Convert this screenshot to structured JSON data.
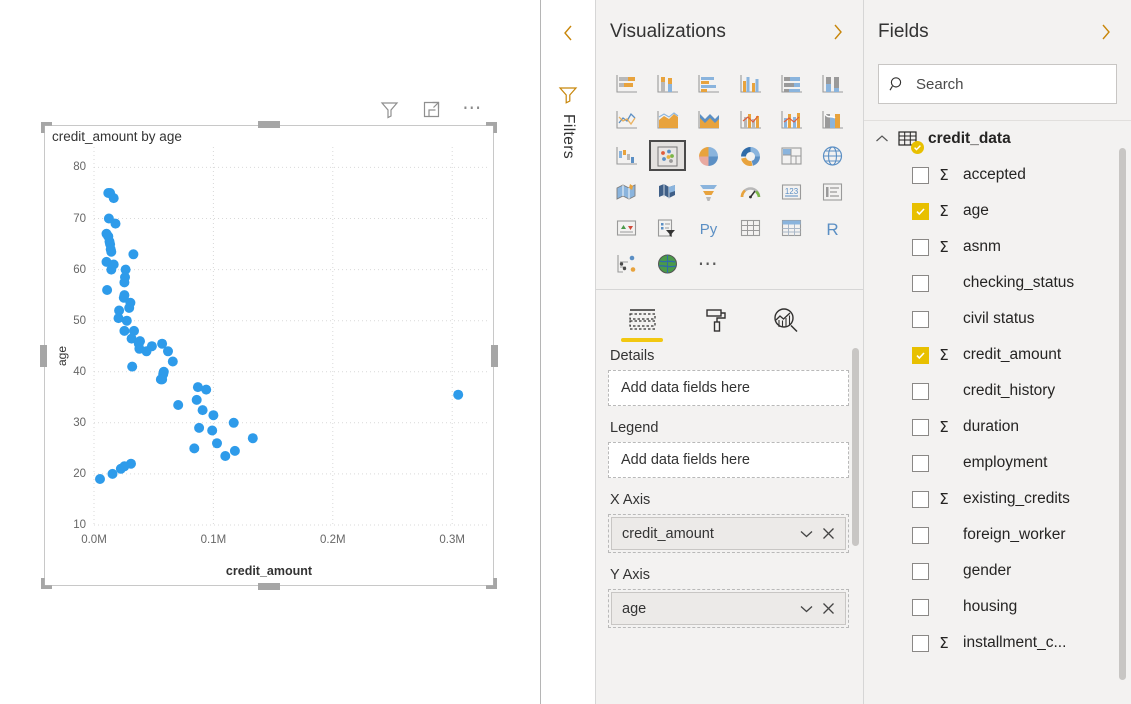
{
  "canvas": {
    "visual_header_icons": [
      {
        "name": "filter-icon",
        "label": "Filters"
      },
      {
        "name": "focus-mode-icon",
        "label": "Focus mode"
      },
      {
        "name": "more-options-icon",
        "label": "More options"
      }
    ]
  },
  "chart_data": {
    "type": "scatter",
    "title": "credit_amount by age",
    "xlabel": "credit_amount",
    "ylabel": "age",
    "xlim": [
      0,
      330000
    ],
    "ylim": [
      10,
      84
    ],
    "grid": true,
    "legend": "none",
    "point_color": "#2e9bea",
    "point_radius": 5,
    "xticks": [
      {
        "value": 0,
        "label": "0.0M"
      },
      {
        "value": 100000,
        "label": "0.1M"
      },
      {
        "value": 200000,
        "label": "0.2M"
      },
      {
        "value": 300000,
        "label": "0.3M"
      }
    ],
    "yticks": [
      {
        "value": 80,
        "label": "80"
      },
      {
        "value": 70,
        "label": "70"
      },
      {
        "value": 60,
        "label": "60"
      },
      {
        "value": 50,
        "label": "50"
      },
      {
        "value": 40,
        "label": "40"
      },
      {
        "value": 30,
        "label": "30"
      },
      {
        "value": 20,
        "label": "20"
      },
      {
        "value": 10,
        "label": "10"
      }
    ],
    "points": [
      {
        "x": 12000,
        "y": 75
      },
      {
        "x": 13500,
        "y": 75
      },
      {
        "x": 16500,
        "y": 74
      },
      {
        "x": 12500,
        "y": 70
      },
      {
        "x": 18000,
        "y": 69
      },
      {
        "x": 10500,
        "y": 67
      },
      {
        "x": 12000,
        "y": 66.5
      },
      {
        "x": 13000,
        "y": 65.5
      },
      {
        "x": 13500,
        "y": 65
      },
      {
        "x": 14000,
        "y": 64
      },
      {
        "x": 14500,
        "y": 63.5
      },
      {
        "x": 33000,
        "y": 63
      },
      {
        "x": 10500,
        "y": 61.5
      },
      {
        "x": 16500,
        "y": 61
      },
      {
        "x": 14500,
        "y": 60
      },
      {
        "x": 26500,
        "y": 60
      },
      {
        "x": 26000,
        "y": 58.5
      },
      {
        "x": 25500,
        "y": 57.5
      },
      {
        "x": 11000,
        "y": 56
      },
      {
        "x": 25500,
        "y": 55
      },
      {
        "x": 25000,
        "y": 54.5
      },
      {
        "x": 30500,
        "y": 53.5
      },
      {
        "x": 21000,
        "y": 52
      },
      {
        "x": 29500,
        "y": 52.5
      },
      {
        "x": 20500,
        "y": 50.5
      },
      {
        "x": 27500,
        "y": 50
      },
      {
        "x": 25500,
        "y": 48
      },
      {
        "x": 33500,
        "y": 48
      },
      {
        "x": 31500,
        "y": 46.5
      },
      {
        "x": 38500,
        "y": 46
      },
      {
        "x": 37500,
        "y": 45.5
      },
      {
        "x": 38000,
        "y": 44.5
      },
      {
        "x": 48500,
        "y": 45
      },
      {
        "x": 57000,
        "y": 45.5
      },
      {
        "x": 44000,
        "y": 44
      },
      {
        "x": 62000,
        "y": 44
      },
      {
        "x": 32000,
        "y": 41
      },
      {
        "x": 66000,
        "y": 42
      },
      {
        "x": 58500,
        "y": 40
      },
      {
        "x": 58000,
        "y": 39.5
      },
      {
        "x": 56000,
        "y": 38.5
      },
      {
        "x": 57000,
        "y": 38.5
      },
      {
        "x": 87000,
        "y": 37
      },
      {
        "x": 94000,
        "y": 36.5
      },
      {
        "x": 305000,
        "y": 35.5
      },
      {
        "x": 86000,
        "y": 34.5
      },
      {
        "x": 70500,
        "y": 33.5
      },
      {
        "x": 91000,
        "y": 32.5
      },
      {
        "x": 100000,
        "y": 31.5
      },
      {
        "x": 117000,
        "y": 30
      },
      {
        "x": 88000,
        "y": 29
      },
      {
        "x": 99000,
        "y": 28.5
      },
      {
        "x": 133000,
        "y": 27
      },
      {
        "x": 103000,
        "y": 26
      },
      {
        "x": 84000,
        "y": 25
      },
      {
        "x": 118000,
        "y": 24.5
      },
      {
        "x": 110000,
        "y": 23.5
      },
      {
        "x": 31000,
        "y": 22
      },
      {
        "x": 22500,
        "y": 21
      },
      {
        "x": 25500,
        "y": 21.5
      },
      {
        "x": 15500,
        "y": 20
      },
      {
        "x": 5000,
        "y": 19
      }
    ]
  },
  "filters_rail": {
    "collapse_label": "Expand filters",
    "title": "Filters"
  },
  "visualizations": {
    "title": "Visualizations",
    "expand_label": "Expand visualizations",
    "icons": [
      "stacked-bar-chart-icon",
      "stacked-column-chart-icon",
      "clustered-bar-chart-icon",
      "clustered-column-chart-icon",
      "hundred-percent-stacked-bar-chart-icon",
      "hundred-percent-stacked-column-chart-icon",
      "line-chart-icon",
      "area-chart-icon",
      "stacked-area-chart-icon",
      "line-stacked-column-chart-icon",
      "line-clustered-column-chart-icon",
      "ribbon-chart-icon",
      "waterfall-chart-icon",
      "scatter-chart-icon",
      "pie-chart-icon",
      "donut-chart-icon",
      "treemap-icon",
      "map-icon",
      "filled-map-icon",
      "shape-map-icon",
      "funnel-chart-icon",
      "gauge-chart-icon",
      "card-icon",
      "multi-row-card-icon",
      "kpi-icon",
      "slicer-icon",
      "python-visual-icon",
      "table-icon",
      "matrix-icon",
      "r-script-visual-icon",
      "key-influencers-icon",
      "arcgis-maps-icon",
      "more-visuals-icon"
    ],
    "selected_icon": "scatter-chart-icon",
    "tabs": [
      {
        "label": "Fields",
        "icon": "fields-well-icon",
        "active": true
      },
      {
        "label": "Format",
        "icon": "paint-roller-icon",
        "active": false
      },
      {
        "label": "Analytics",
        "icon": "analytics-magnifier-icon",
        "active": false
      }
    ],
    "wells": [
      {
        "label": "Details",
        "type": "empty",
        "placeholder": "Add data fields here"
      },
      {
        "label": "Legend",
        "type": "empty",
        "placeholder": "Add data fields here"
      },
      {
        "label": "X Axis",
        "type": "field",
        "value": "credit_amount"
      },
      {
        "label": "Y Axis",
        "type": "field",
        "value": "age"
      }
    ]
  },
  "fields": {
    "title": "Fields",
    "expand_label": "Expand fields",
    "search": {
      "placeholder": "Search",
      "value": "Search"
    },
    "table": {
      "name": "credit_data",
      "expanded": true,
      "icon": "table-icon"
    },
    "items": [
      {
        "label": "accepted",
        "checked": false,
        "numeric": true
      },
      {
        "label": "age",
        "checked": true,
        "numeric": true
      },
      {
        "label": "asnm",
        "checked": false,
        "numeric": true
      },
      {
        "label": "checking_status",
        "checked": false,
        "numeric": false
      },
      {
        "label": "civil status",
        "checked": false,
        "numeric": false
      },
      {
        "label": "credit_amount",
        "checked": true,
        "numeric": true
      },
      {
        "label": "credit_history",
        "checked": false,
        "numeric": false
      },
      {
        "label": "duration",
        "checked": false,
        "numeric": true
      },
      {
        "label": "employment",
        "checked": false,
        "numeric": false
      },
      {
        "label": "existing_credits",
        "checked": false,
        "numeric": true
      },
      {
        "label": "foreign_worker",
        "checked": false,
        "numeric": false
      },
      {
        "label": "gender",
        "checked": false,
        "numeric": false
      },
      {
        "label": "housing",
        "checked": false,
        "numeric": false
      },
      {
        "label": "installment_c...",
        "checked": false,
        "numeric": true
      }
    ]
  },
  "colors": {
    "accent_yellow": "#e8c000",
    "chart_point": "#2e9bea",
    "pane_bg": "#f3f2f1",
    "chevron_orange": "#c8860a"
  }
}
